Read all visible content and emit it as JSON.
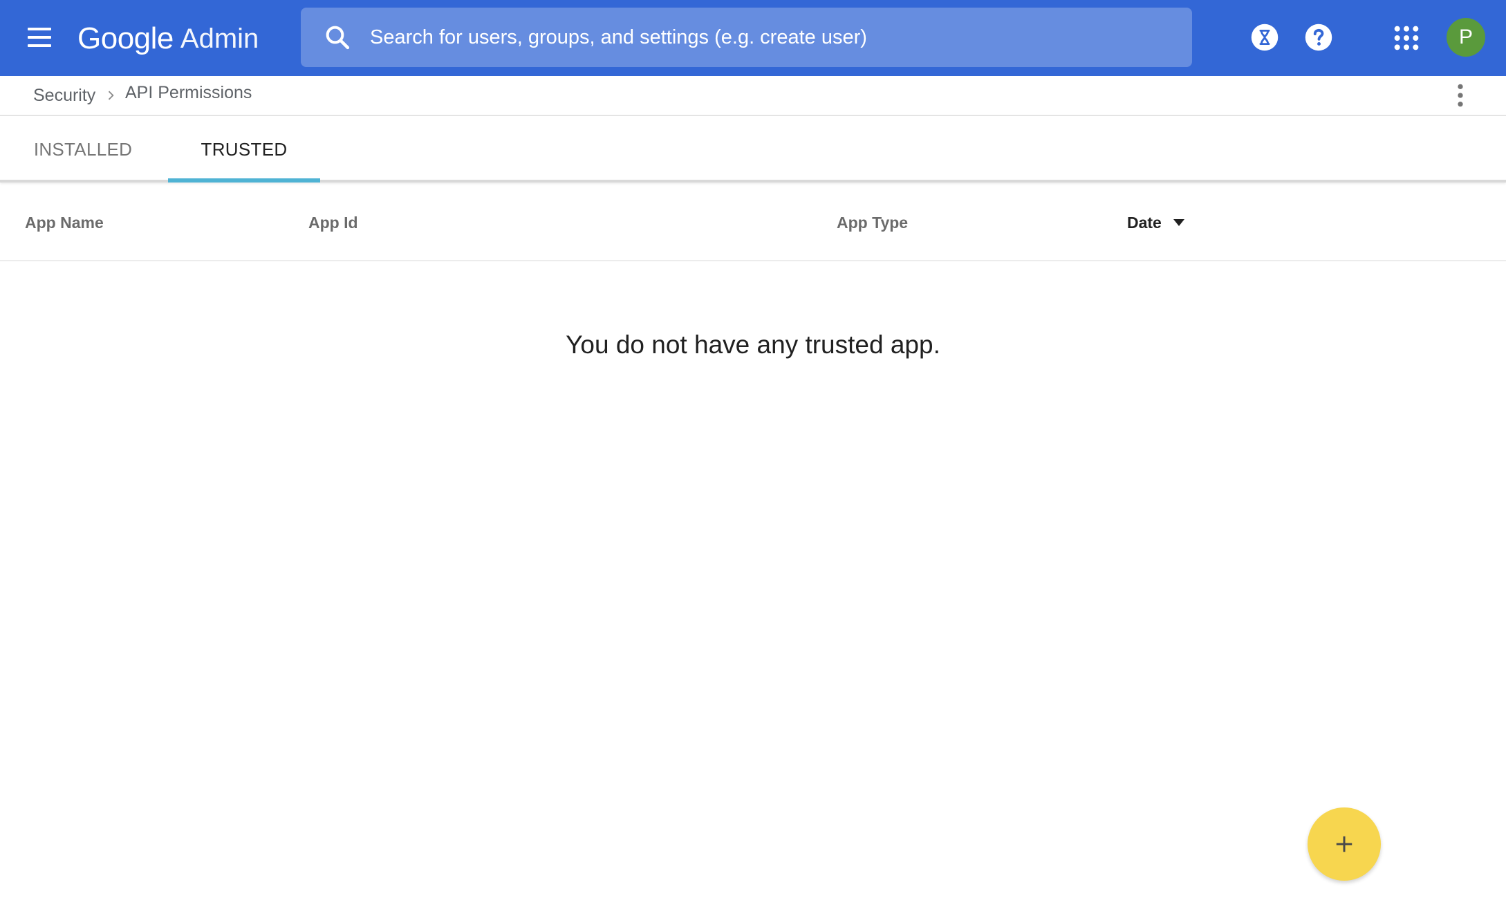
{
  "header": {
    "logo_google": "Google",
    "logo_admin": "Admin",
    "search_placeholder": "Search for users, groups, and settings (e.g. create user)",
    "avatar_initial": "P",
    "icons": [
      "menu-icon",
      "search-icon",
      "hourglass-icon",
      "help-icon",
      "apps-grid-icon"
    ],
    "bar_color": "#3367d6"
  },
  "breadcrumb": {
    "items": [
      "Security",
      "API Permissions"
    ]
  },
  "tabs": [
    {
      "label": "INSTALLED",
      "selected": false
    },
    {
      "label": "TRUSTED",
      "selected": true
    }
  ],
  "table": {
    "columns": [
      "App Name",
      "App Id",
      "App Type",
      "Date"
    ],
    "sort_column": "Date",
    "sort_direction": "descending",
    "rows": [],
    "empty_message": "You do not have any trusted app."
  },
  "fab": {
    "icon": "plus-icon",
    "color": "#f7d64f"
  }
}
